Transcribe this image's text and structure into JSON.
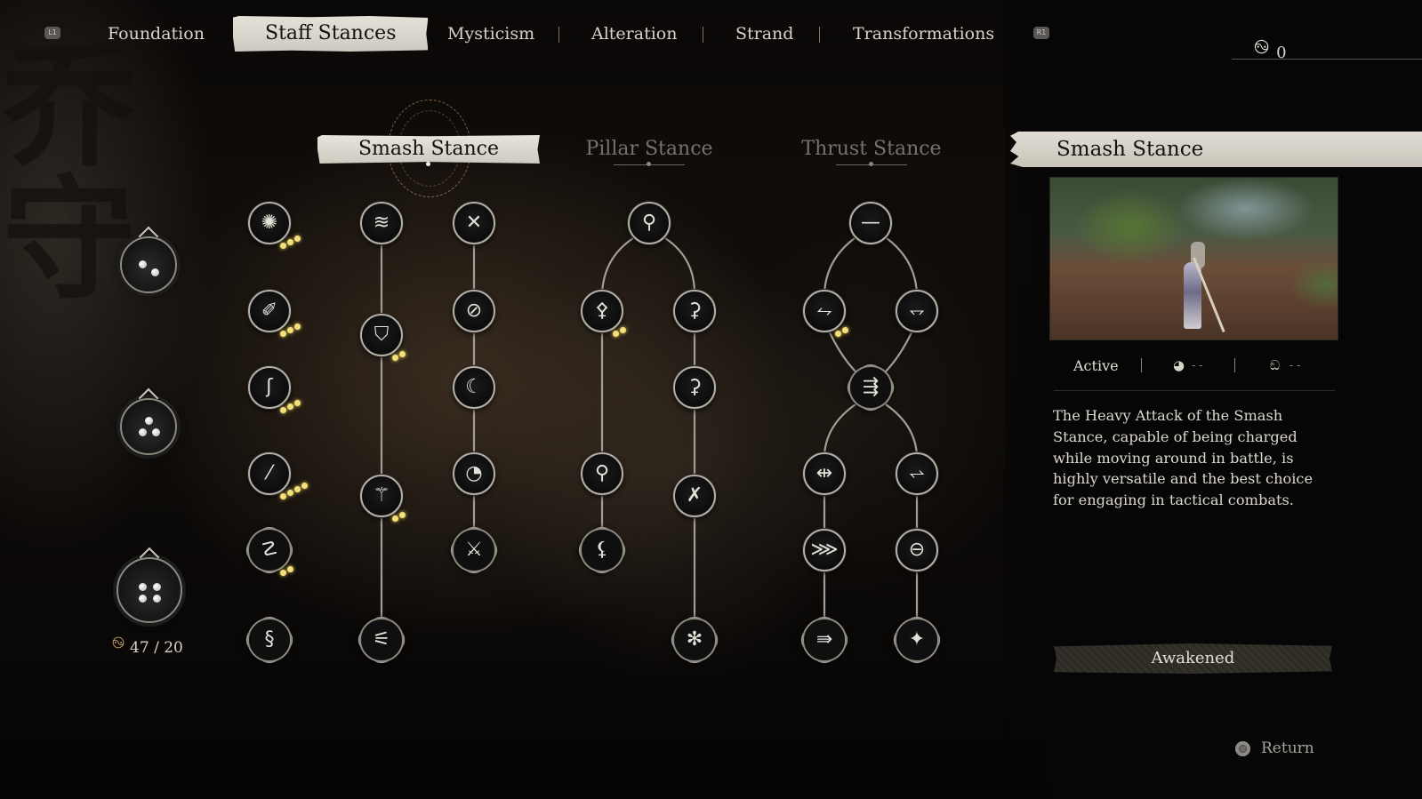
{
  "nav": {
    "left_bumper": "L1",
    "right_bumper": "R1",
    "tabs": [
      {
        "label": "Foundation",
        "active": false
      },
      {
        "label": "Staff Stances",
        "active": true
      },
      {
        "label": "Mysticism",
        "active": false
      },
      {
        "label": "Alteration",
        "active": false
      },
      {
        "label": "Strand",
        "active": false
      },
      {
        "label": "Transformations",
        "active": false
      }
    ],
    "currency": {
      "icon": "spark-swirl-icon",
      "value": "0"
    }
  },
  "background": {
    "calligraphy": "乔守"
  },
  "stances": [
    {
      "label": "Smash Stance",
      "active": true
    },
    {
      "label": "Pillar Stance",
      "active": false
    },
    {
      "label": "Thrust Stance",
      "active": false
    }
  ],
  "tiers": [
    {
      "name": "tier-1",
      "dots": 2
    },
    {
      "name": "tier-2",
      "dots": 3
    },
    {
      "name": "tier-3",
      "dots": 4
    }
  ],
  "sparks": {
    "icon": "spark-swirl-icon",
    "spent": "47",
    "required": "20",
    "display": "47 / 20"
  },
  "tree": {
    "smash_passives": [
      {
        "icon": "flame-orb-icon",
        "glyph": "✺",
        "shape": "circle",
        "pips": 3
      },
      {
        "icon": "staff-burst-icon",
        "glyph": "✐",
        "shape": "circle",
        "pips": 3
      },
      {
        "icon": "hook-swing-icon",
        "glyph": "ʃ",
        "shape": "circle",
        "pips": 3
      },
      {
        "icon": "staff-dash-icon",
        "glyph": "⁄",
        "shape": "circle",
        "pips": 4
      },
      {
        "icon": "coiled-staff-icon",
        "glyph": "☡",
        "shape": "ornate",
        "pips": 2
      },
      {
        "icon": "spiral-swing-icon",
        "glyph": "§",
        "shape": "ornate",
        "pips": 0
      }
    ],
    "smash_mid": [
      {
        "icon": "staff-wind-icon",
        "glyph": "≋",
        "shape": "circle",
        "pips": 0
      },
      {
        "icon": "staff-shield-icon",
        "glyph": "⛉",
        "shape": "circle",
        "pips": 2
      },
      {
        "icon": "staff-leap-icon",
        "glyph": "⚚",
        "shape": "circle",
        "pips": 2
      },
      {
        "icon": "staff-flame-icon",
        "glyph": "⚟",
        "shape": "ornate",
        "pips": 0
      }
    ],
    "smash_right": [
      {
        "icon": "crossed-staves-icon",
        "glyph": "✕",
        "shape": "circle",
        "pips": 0
      },
      {
        "icon": "slash-circle-icon",
        "glyph": "⊘",
        "shape": "circle",
        "pips": 0
      },
      {
        "icon": "crescent-sweep-icon",
        "glyph": "☾",
        "shape": "circle",
        "pips": 0
      },
      {
        "icon": "crescent-flame-icon",
        "glyph": "◔",
        "shape": "circle",
        "pips": 0
      },
      {
        "icon": "crossed-flame-icon",
        "glyph": "⚔",
        "shape": "ornate",
        "pips": 0
      }
    ],
    "pillar": [
      {
        "icon": "pillar-top-icon",
        "glyph": "⚲",
        "shape": "circle",
        "pips": 0
      },
      {
        "icon": "pillar-roots-icon",
        "glyph": "⚴",
        "shape": "circle",
        "pips": 2
      },
      {
        "icon": "pillar-spin-icon",
        "glyph": "⚳",
        "shape": "circle",
        "pips": 0
      },
      {
        "icon": "pillar-whirl-icon",
        "glyph": "⚳",
        "shape": "circle",
        "pips": 0
      },
      {
        "icon": "pillar-bloom-icon",
        "glyph": "⚲",
        "shape": "circle",
        "pips": 0
      },
      {
        "icon": "x-cross-icon",
        "glyph": "✗",
        "shape": "circle",
        "pips": 0
      },
      {
        "icon": "pillar-fall-icon",
        "glyph": "⚸",
        "shape": "ornate",
        "pips": 0
      },
      {
        "icon": "pinwheel-icon",
        "glyph": "✻",
        "shape": "ornate",
        "pips": 0
      }
    ],
    "thrust": [
      {
        "icon": "thrust-line-icon",
        "glyph": "—",
        "shape": "circle",
        "pips": 0
      },
      {
        "icon": "thrust-wave-icon",
        "glyph": "⥊",
        "shape": "circle",
        "pips": 2
      },
      {
        "icon": "thrust-hook-icon",
        "glyph": "⥐",
        "shape": "circle",
        "pips": 0
      },
      {
        "icon": "thrust-barrage-icon",
        "glyph": "⇶",
        "shape": "ornate",
        "pips": 0
      },
      {
        "icon": "thrust-cross-icon",
        "glyph": "⇹",
        "shape": "circle",
        "pips": 0
      },
      {
        "icon": "thrust-curl-icon",
        "glyph": "⥋",
        "shape": "circle",
        "pips": 0
      },
      {
        "icon": "thrust-feather-icon",
        "glyph": "⋙",
        "shape": "circle",
        "pips": 0
      },
      {
        "icon": "thrust-orbit-icon",
        "glyph": "⊖",
        "shape": "circle",
        "pips": 0
      },
      {
        "icon": "thrust-fury-icon",
        "glyph": "⇛",
        "shape": "ornate",
        "pips": 0
      },
      {
        "icon": "thrust-star-icon",
        "glyph": "✦",
        "shape": "ornate",
        "pips": 0
      }
    ]
  },
  "detail": {
    "title": "Smash Stance",
    "preview_alt": "Smash Stance preview",
    "status": "Active",
    "stat1": {
      "icon": "focus-orb-icon",
      "glyph": "◕",
      "value": "- -"
    },
    "stat2": {
      "icon": "mana-swirl-icon",
      "glyph": "ඞ",
      "value": "- -"
    },
    "description": "The Heavy Attack of the Smash Stance, capable of being charged while moving around in battle, is highly versatile and the best choice for engaging in tactical combats.",
    "button_label": "Awakened"
  },
  "footer": {
    "return_label": "Return",
    "return_icon": "circle-button-icon"
  }
}
